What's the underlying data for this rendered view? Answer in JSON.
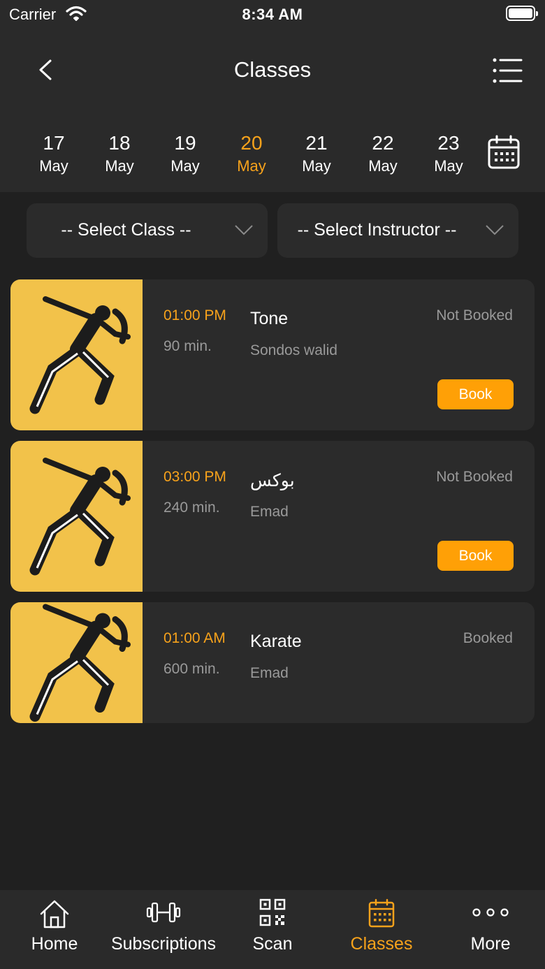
{
  "status_bar": {
    "carrier": "Carrier",
    "time": "8:34 AM"
  },
  "header": {
    "title": "Classes",
    "back_icon": "chevron-left-icon",
    "list_icon": "list-icon"
  },
  "dates": [
    {
      "day": "17",
      "month": "May",
      "active": false
    },
    {
      "day": "18",
      "month": "May",
      "active": false
    },
    {
      "day": "19",
      "month": "May",
      "active": false
    },
    {
      "day": "20",
      "month": "May",
      "active": true
    },
    {
      "day": "21",
      "month": "May",
      "active": false
    },
    {
      "day": "22",
      "month": "May",
      "active": false
    },
    {
      "day": "23",
      "month": "May",
      "active": false
    }
  ],
  "filters": {
    "class_label": "-- Select Class --",
    "instructor_label": "-- Select Instructor --"
  },
  "classes": [
    {
      "time": "01:00 PM",
      "duration": "90 min.",
      "name": "Tone",
      "instructor": "Sondos walid",
      "status": "Not Booked",
      "book_label": "Book"
    },
    {
      "time": "03:00 PM",
      "duration": "240 min.",
      "name": "بوكس",
      "instructor": "Emad",
      "status": "Not Booked",
      "book_label": "Book"
    },
    {
      "time": "01:00 AM",
      "duration": "600 min.",
      "name": "Karate",
      "instructor": "Emad",
      "status": "Booked"
    }
  ],
  "tabs": [
    {
      "label": "Home",
      "icon": "home-icon",
      "active": false
    },
    {
      "label": "Subscriptions",
      "icon": "dumbbell-icon",
      "active": false
    },
    {
      "label": "Scan",
      "icon": "qr-code-icon",
      "active": false
    },
    {
      "label": "Classes",
      "icon": "calendar-icon",
      "active": true
    },
    {
      "label": "More",
      "icon": "more-icon",
      "active": false
    }
  ],
  "colors": {
    "accent": "#f7a21b",
    "button": "#ffa006",
    "background": "#202020",
    "surface": "#2b2b2b",
    "muted_text": "#9a9a9a",
    "image_bg": "#f2c24a"
  }
}
